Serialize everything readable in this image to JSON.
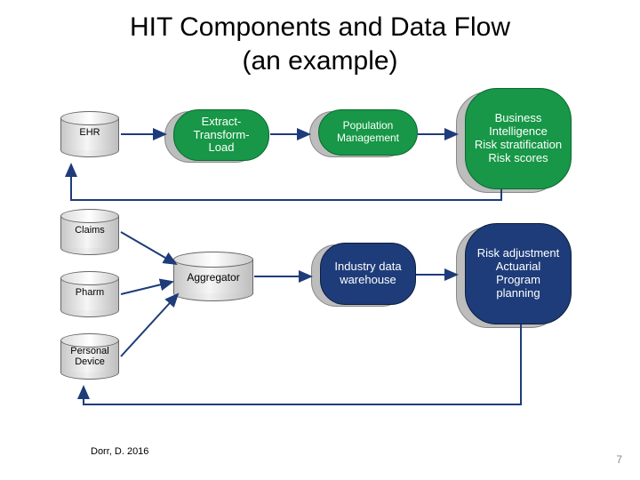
{
  "title_line1": "HIT Components and Data Flow",
  "title_line2": "(an example)",
  "sources": {
    "ehr": "EHR",
    "claims": "Claims",
    "pharm": "Pharm",
    "device": "Personal Device"
  },
  "etl": "Extract-Transform-Load",
  "popmgmt": "Population Management",
  "bi": "Business Intelligence\nRisk stratification\nRisk scores",
  "aggregator": "Aggregator",
  "idw": "Industry data warehouse",
  "risk": "Risk adjustment\nActuarial\nProgram planning",
  "citation": "Dorr, D. 2016",
  "page_number": "7"
}
